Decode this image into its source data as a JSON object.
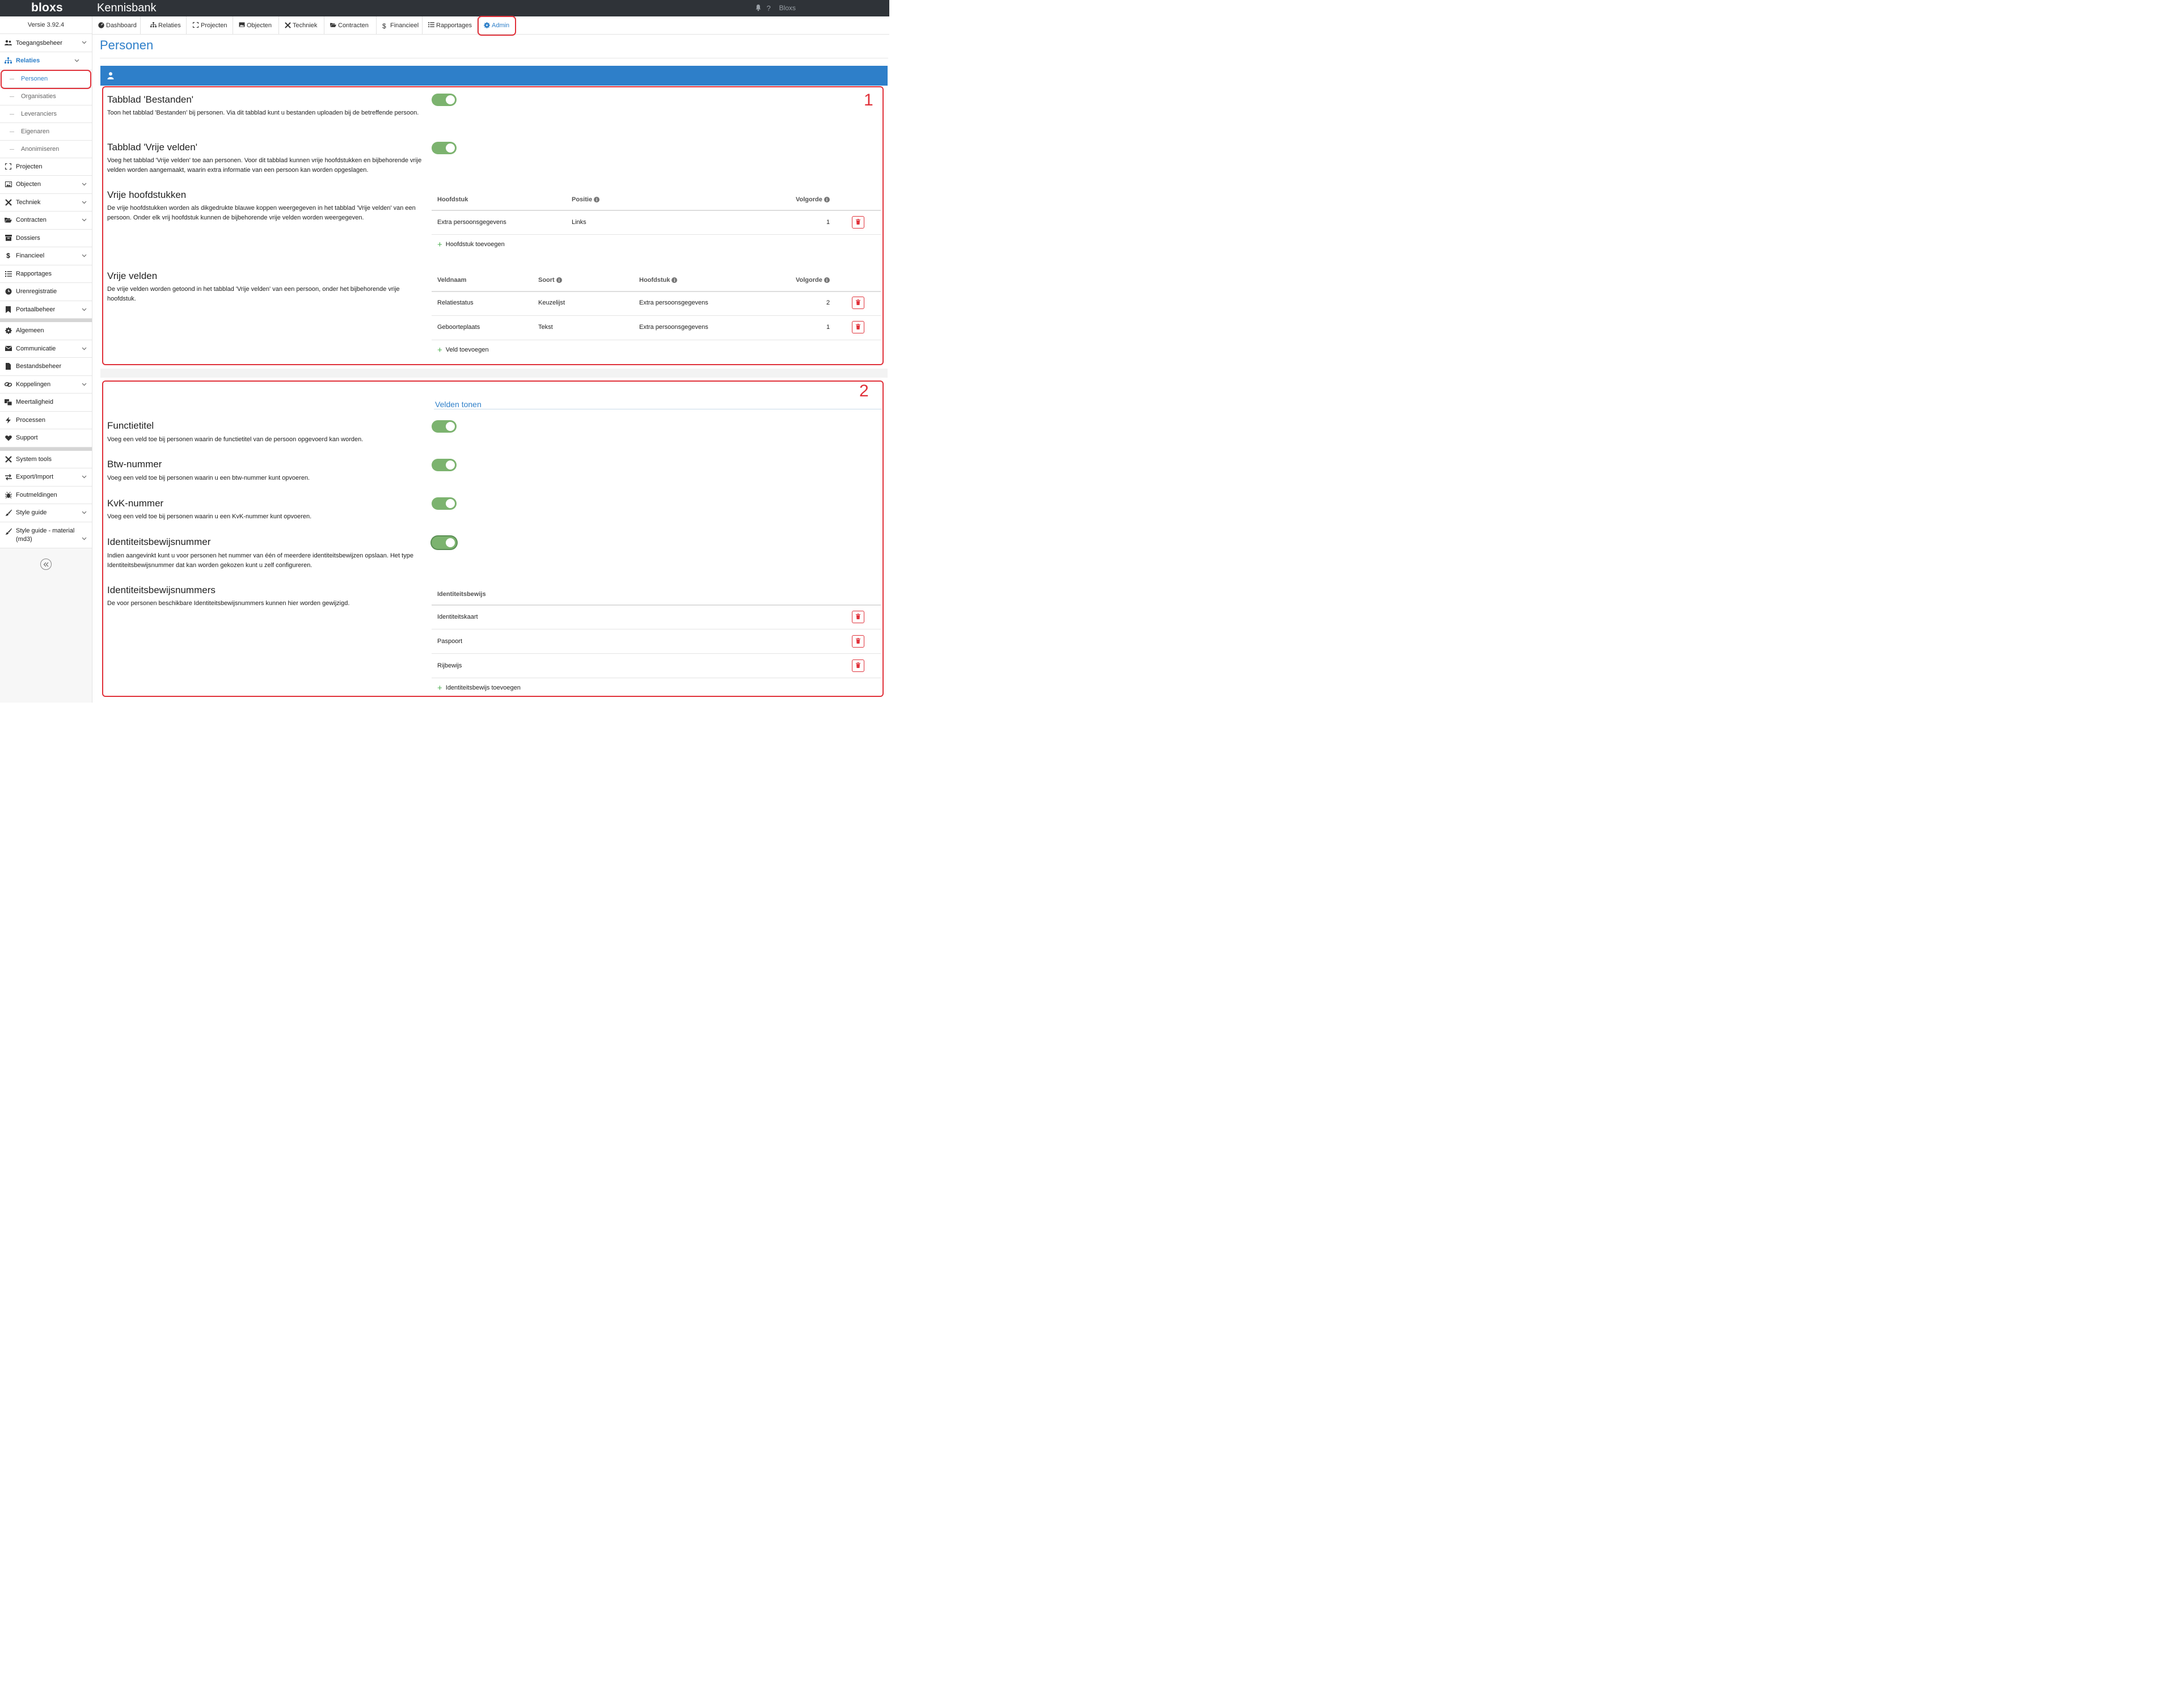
{
  "topbar": {
    "logo": "bloxs",
    "title": "Kennisbank",
    "user": "Bloxs"
  },
  "sidebar": {
    "version": "Versie 3.92.4",
    "items": {
      "toegangsbeheer": "Toegangsbeheer",
      "relaties": "Relaties",
      "personen": "Personen",
      "organisaties": "Organisaties",
      "leveranciers": "Leveranciers",
      "eigenaren": "Eigenaren",
      "anonimiseren": "Anonimiseren",
      "projecten": "Projecten",
      "objecten": "Objecten",
      "techniek": "Techniek",
      "contracten": "Contracten",
      "dossiers": "Dossiers",
      "financieel": "Financieel",
      "rapportages": "Rapportages",
      "urenregistratie": "Urenregistratie",
      "portaalbeheer": "Portaalbeheer",
      "algemeen": "Algemeen",
      "communicatie": "Communicatie",
      "bestandsbeheer": "Bestandsbeheer",
      "koppelingen": "Koppelingen",
      "meertaligheid": "Meertaligheid",
      "processen": "Processen",
      "support": "Support",
      "system_tools": "System tools",
      "export_import": "Export/Import",
      "foutmeldingen": "Foutmeldingen",
      "style_guide": "Style guide",
      "style_guide_material": "Style guide - material (md3)"
    }
  },
  "tabs": {
    "dashboard": "Dashboard",
    "relaties": "Relaties",
    "projecten": "Projecten",
    "objecten": "Objecten",
    "techniek": "Techniek",
    "contracten": "Contracten",
    "financieel": "Financieel",
    "rapportages": "Rapportages",
    "admin": "Admin"
  },
  "page": {
    "title": "Personen"
  },
  "section1": {
    "number": "1",
    "bestanden": {
      "title": "Tabblad 'Bestanden'",
      "desc": "Toon het tabblad 'Bestanden' bij personen. Via dit tabblad kunt u bestanden uploaden bij de betreffende persoon.",
      "enabled": true
    },
    "vrije_velden_tab": {
      "title": "Tabblad 'Vrije velden'",
      "desc": "Voeg het tabblad 'Vrije velden' toe aan personen. Voor dit tabblad kunnen vrije hoofdstukken en bijbehorende vrije velden worden aangemaakt, waarin extra informatie van een persoon kan worden opgeslagen.",
      "enabled": true
    },
    "vrije_hoofdstukken": {
      "title": "Vrije hoofdstukken",
      "desc": "De vrije hoofdstukken worden als dikgedrukte blauwe koppen weergegeven in het tabblad 'Vrije velden' van een persoon. Onder elk vrij hoofdstuk kunnen de bijbehorende vrije velden worden weergegeven.",
      "headers": {
        "hoofdstuk": "Hoofdstuk",
        "positie": "Positie",
        "volgorde": "Volgorde"
      },
      "rows": [
        {
          "hoofdstuk": "Extra persoonsgegevens",
          "positie": "Links",
          "volgorde": "1"
        }
      ],
      "add_label": "Hoofdstuk toevoegen"
    },
    "vrije_velden": {
      "title": "Vrije velden",
      "desc": "De vrije velden worden getoond in het tabblad 'Vrije velden' van een persoon, onder het bijbehorende vrije hoofdstuk.",
      "headers": {
        "veldnaam": "Veldnaam",
        "soort": "Soort",
        "hoofdstuk": "Hoofdstuk",
        "volgorde": "Volgorde"
      },
      "rows": [
        {
          "veldnaam": "Relatiestatus",
          "soort": "Keuzelijst",
          "hoofdstuk": "Extra persoonsgegevens",
          "volgorde": "2"
        },
        {
          "veldnaam": "Geboorteplaats",
          "soort": "Tekst",
          "hoofdstuk": "Extra persoonsgegevens",
          "volgorde": "1"
        }
      ],
      "add_label": "Veld toevoegen"
    }
  },
  "section2": {
    "number": "2",
    "heading": "Velden tonen",
    "functietitel": {
      "title": "Functietitel",
      "desc": "Voeg een veld toe bij personen waarin de functietitel van de persoon opgevoerd kan worden.",
      "enabled": true
    },
    "btw": {
      "title": "Btw-nummer",
      "desc": "Voeg een veld toe bij personen waarin u een btw-nummer kunt opvoeren.",
      "enabled": true
    },
    "kvk": {
      "title": "KvK-nummer",
      "desc": "Voeg een veld toe bij personen waarin u een KvK-nummer kunt opvoeren.",
      "enabled": true
    },
    "idnummer": {
      "title": "Identiteitsbewijsnummer",
      "desc": "Indien aangevinkt kunt u voor personen het nummer van één of meerdere identiteitsbewijzen opslaan. Het type Identiteitsbewijsnummer dat kan worden gekozen kunt u zelf configureren.",
      "enabled": true
    },
    "idnummers": {
      "title": "Identiteitsbewijsnummers",
      "desc": "De voor personen beschikbare Identiteitsbewijsnummers kunnen hier worden gewijzigd.",
      "header": "Identiteitsbewijs",
      "rows": [
        "Identiteitskaart",
        "Paspoort",
        "Rijbewijs"
      ],
      "add_label": "Identiteitsbewijs toevoegen"
    }
  },
  "colors": {
    "brand_blue": "#2e7fc9",
    "topbar": "#2f3338",
    "highlight_red": "#e0313a",
    "toggle_green": "#7cb36f"
  }
}
